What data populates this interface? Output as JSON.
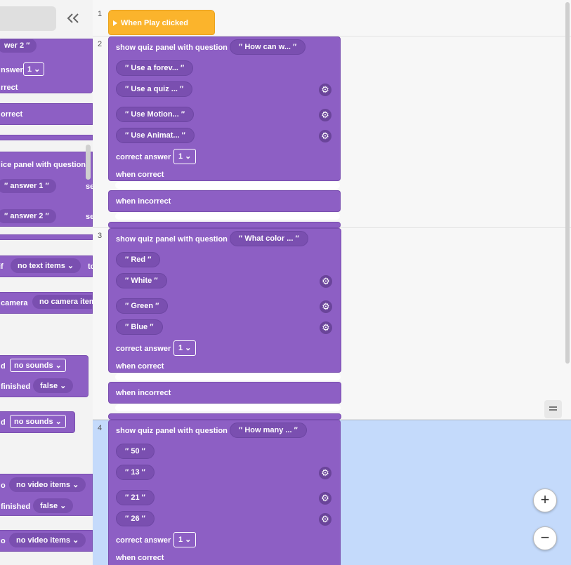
{
  "palette": {
    "collapse_glyph": "«",
    "items": [
      {
        "text": "wer 2 ″"
      },
      {
        "text": "nswer"
      },
      {
        "text": "1 ⌄"
      },
      {
        "text": "rrect"
      },
      {
        "text": "orrect"
      },
      {
        "text": "ice panel with question"
      },
      {
        "text": "″ answer 1 ″"
      },
      {
        "text": "selecte"
      },
      {
        "text": "″ answer 2 ″"
      },
      {
        "text": "selecte"
      },
      {
        "text": "if"
      },
      {
        "text": "no text items ⌄"
      },
      {
        "text": "to"
      },
      {
        "text": "camera"
      },
      {
        "text": "no camera item"
      },
      {
        "text": "d"
      },
      {
        "text": "no sounds ⌄"
      },
      {
        "text": "finished"
      },
      {
        "text": "false ⌄"
      },
      {
        "text": "d"
      },
      {
        "text": "no sounds ⌄"
      },
      {
        "text": "o"
      },
      {
        "text": "no video items ⌄"
      },
      {
        "text": "finished"
      },
      {
        "text": "false ⌄"
      },
      {
        "text": "o"
      },
      {
        "text": "no video items ⌄"
      }
    ]
  },
  "workspace": {
    "rows": [
      "1",
      "2",
      "3",
      "4"
    ],
    "event_block": "When Play clicked",
    "quiz_label": "show quiz panel with question",
    "correct_answer_label": "correct answer",
    "when_correct_label": "when correct",
    "when_incorrect_label": "when incorrect",
    "quizzes": [
      {
        "question": "″ How can w... ″",
        "answers": [
          "″ Use a forev... ″",
          "″ Use a quiz ... ″",
          "″ Use Motion... ″",
          "″ Use Animat... ″"
        ],
        "correct": "1 ⌄"
      },
      {
        "question": "″ What color ... ″",
        "answers": [
          "″ Red ″",
          "″ White ″",
          "″ Green ″",
          "″ Blue ″"
        ],
        "correct": "1 ⌄"
      },
      {
        "question": "″ How many ... ″",
        "answers": [
          "″ 50 ″",
          "″ 13 ″",
          "″ 21 ″",
          "″ 26 ″"
        ],
        "correct": "1 ⌄"
      }
    ],
    "zoom_in": "+",
    "zoom_out": "−",
    "colors": {
      "event": "#fbb42c",
      "block": "#8d5fc4",
      "selected_row": "#c4dafb"
    }
  }
}
